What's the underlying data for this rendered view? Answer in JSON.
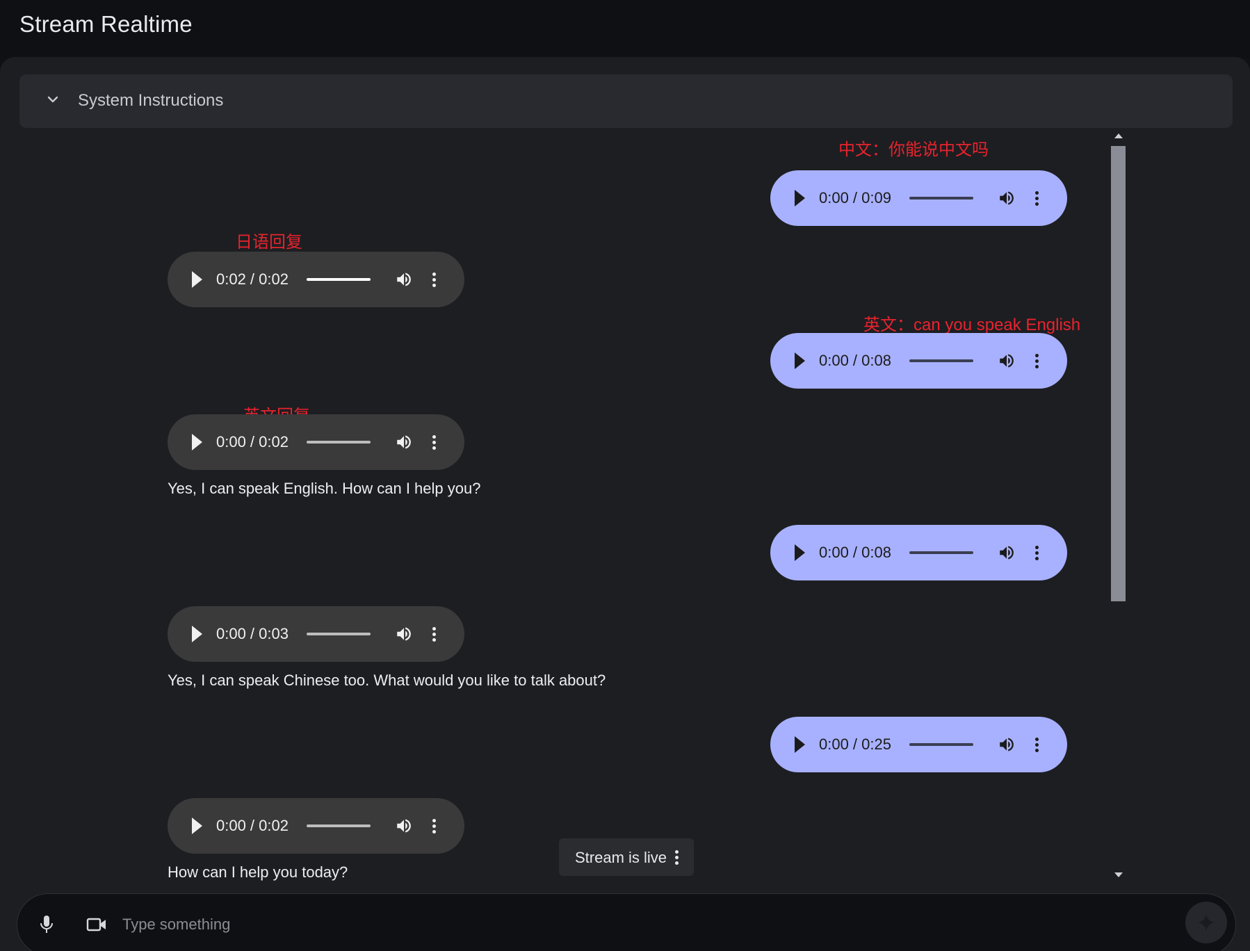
{
  "app": {
    "title": "Stream Realtime"
  },
  "system_instructions": {
    "label": "System Instructions",
    "icon": "chevron-down-icon"
  },
  "messages": [
    {
      "role": "user",
      "annotation": "中文：你能说中文吗",
      "time": "0:00 / 0:09",
      "progress": 0
    },
    {
      "role": "model",
      "annotation": "日语回复",
      "time": "0:02 / 0:02",
      "progress": 1
    },
    {
      "role": "user",
      "annotation": "英文：can you speak English",
      "time": "0:00 / 0:08",
      "progress": 0
    },
    {
      "role": "model",
      "annotation": "英文回复",
      "time": "0:00 / 0:02",
      "progress": 0,
      "text": "Yes, I can speak English. How can I help you?"
    },
    {
      "role": "user",
      "time": "0:00 / 0:08",
      "progress": 0
    },
    {
      "role": "model",
      "time": "0:00 / 0:03",
      "progress": 0,
      "text": "Yes, I can speak Chinese too. What would you like to talk about?"
    },
    {
      "role": "user",
      "time": "0:00 / 0:25",
      "progress": 0
    },
    {
      "role": "model",
      "time": "0:00 / 0:02",
      "progress": 0,
      "text": "How can I help you today?"
    }
  ],
  "stream_status": {
    "label": "Stream is live"
  },
  "input": {
    "placeholder": "Type something"
  },
  "colors": {
    "user_bubble": "#a8b1ff",
    "model_bubble": "#3a3a3b",
    "annotation": "#e8232e",
    "panel_bg": "#1d1e21"
  }
}
